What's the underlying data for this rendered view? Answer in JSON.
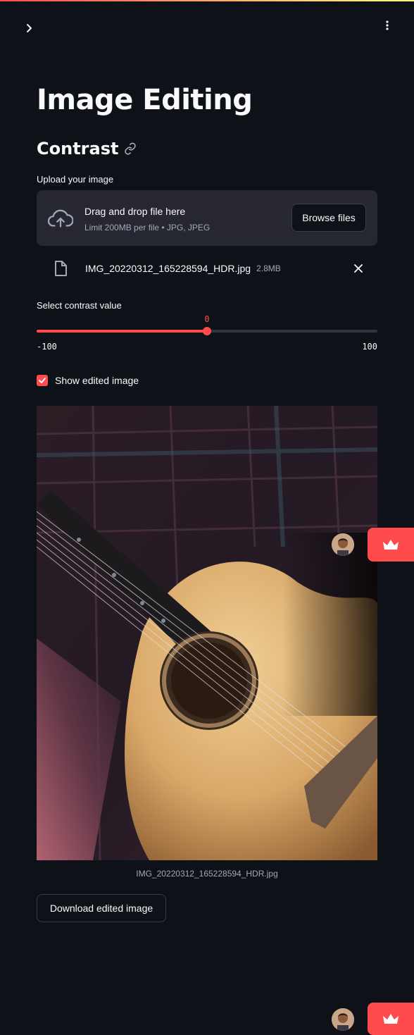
{
  "page": {
    "title": "Image Editing",
    "subheader": "Contrast"
  },
  "uploader": {
    "label": "Upload your image",
    "drop_title": "Drag and drop file here",
    "drop_limit": "Limit 200MB per file • JPG, JPEG",
    "browse_label": "Browse files",
    "file": {
      "name": "IMG_20220312_165228594_HDR.jpg",
      "size": "2.8MB"
    }
  },
  "slider": {
    "label": "Select contrast value",
    "value": "0",
    "min": "-100",
    "max": "100",
    "fraction": 0.5
  },
  "checkbox": {
    "label": "Show edited image",
    "checked": true
  },
  "image": {
    "caption": "IMG_20220312_165228594_HDR.jpg"
  },
  "download": {
    "label": "Download edited image"
  },
  "colors": {
    "accent": "#ff4b4b",
    "background": "#0e1117",
    "secondary_bg": "#262730"
  },
  "icons": [
    "chevron-right-icon",
    "kebab-menu-icon",
    "link-icon",
    "cloud-upload-icon",
    "file-icon",
    "close-icon",
    "check-icon",
    "crown-icon"
  ]
}
